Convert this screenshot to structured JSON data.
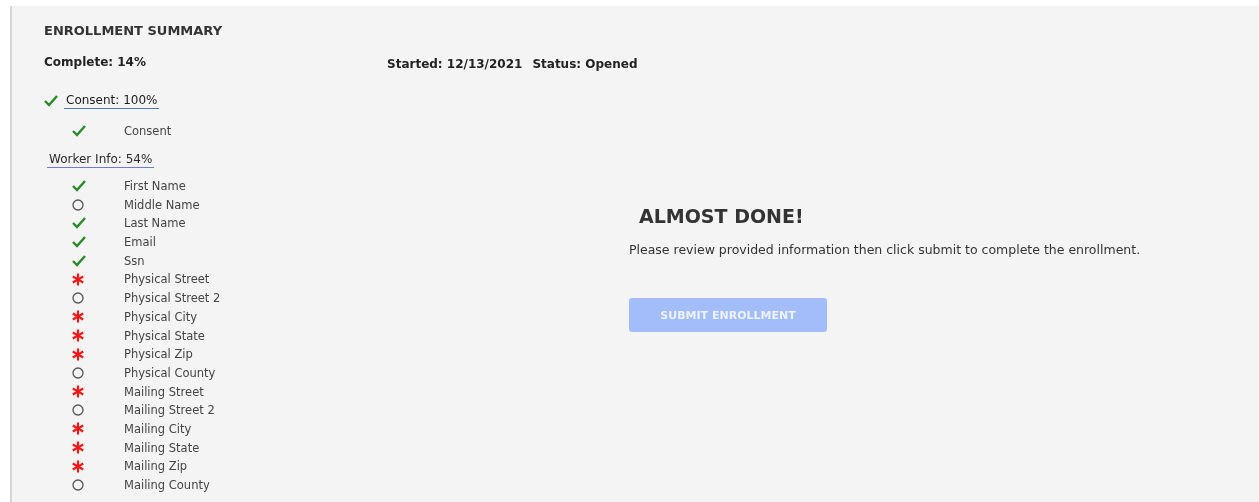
{
  "summary": {
    "title": "ENROLLMENT SUMMARY",
    "complete": "Complete: 14%",
    "started": "Started: 12/13/2021",
    "status": "Status: Opened"
  },
  "sections": [
    {
      "title": "Consent: 100%",
      "complete": true,
      "items": [
        {
          "label": "Consent",
          "kind": "done"
        }
      ]
    },
    {
      "title": "Worker Info: 54%",
      "complete": false,
      "items": [
        {
          "label": "First Name",
          "kind": "done"
        },
        {
          "label": "Middle Name",
          "kind": "optional"
        },
        {
          "label": "Last Name",
          "kind": "done"
        },
        {
          "label": "Email",
          "kind": "done"
        },
        {
          "label": "Ssn",
          "kind": "done"
        },
        {
          "label": "Physical Street",
          "kind": "missing"
        },
        {
          "label": "Physical Street 2",
          "kind": "optional"
        },
        {
          "label": "Physical City",
          "kind": "missing"
        },
        {
          "label": "Physical State",
          "kind": "missing"
        },
        {
          "label": "Physical Zip",
          "kind": "missing"
        },
        {
          "label": "Physical County",
          "kind": "optional"
        },
        {
          "label": "Mailing Street",
          "kind": "missing"
        },
        {
          "label": "Mailing Street 2",
          "kind": "optional"
        },
        {
          "label": "Mailing City",
          "kind": "missing"
        },
        {
          "label": "Mailing State",
          "kind": "missing"
        },
        {
          "label": "Mailing Zip",
          "kind": "missing"
        },
        {
          "label": "Mailing County",
          "kind": "optional"
        }
      ]
    }
  ],
  "finish": {
    "heading": "ALMOST DONE!",
    "message": "Please review provided information then click submit to complete the enrollment.",
    "button": {
      "label": "SUBMIT ENROLLMENT",
      "disabled": true
    }
  }
}
